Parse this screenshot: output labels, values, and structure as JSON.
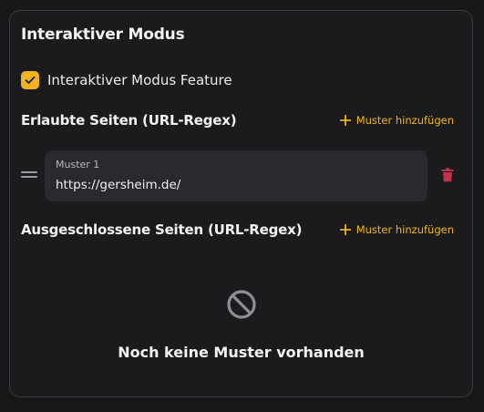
{
  "section": {
    "title": "Interaktiver Modus"
  },
  "feature": {
    "label": "Interaktiver Modus Feature",
    "checked": true
  },
  "allowed": {
    "title": "Erlaubte Seiten (URL-Regex)",
    "add_label": "Muster hinzufügen",
    "patterns": [
      {
        "label": "Muster 1",
        "value": "https://gersheim.de/"
      }
    ]
  },
  "excluded": {
    "title": "Ausgeschlossene Seiten (URL-Regex)",
    "add_label": "Muster hinzufügen",
    "empty_text": "Noch keine Muster vorhanden"
  },
  "colors": {
    "accent": "#f0b423",
    "delete": "#c2324a",
    "background": "#1b1b1d",
    "field": "#2a2a2e"
  }
}
